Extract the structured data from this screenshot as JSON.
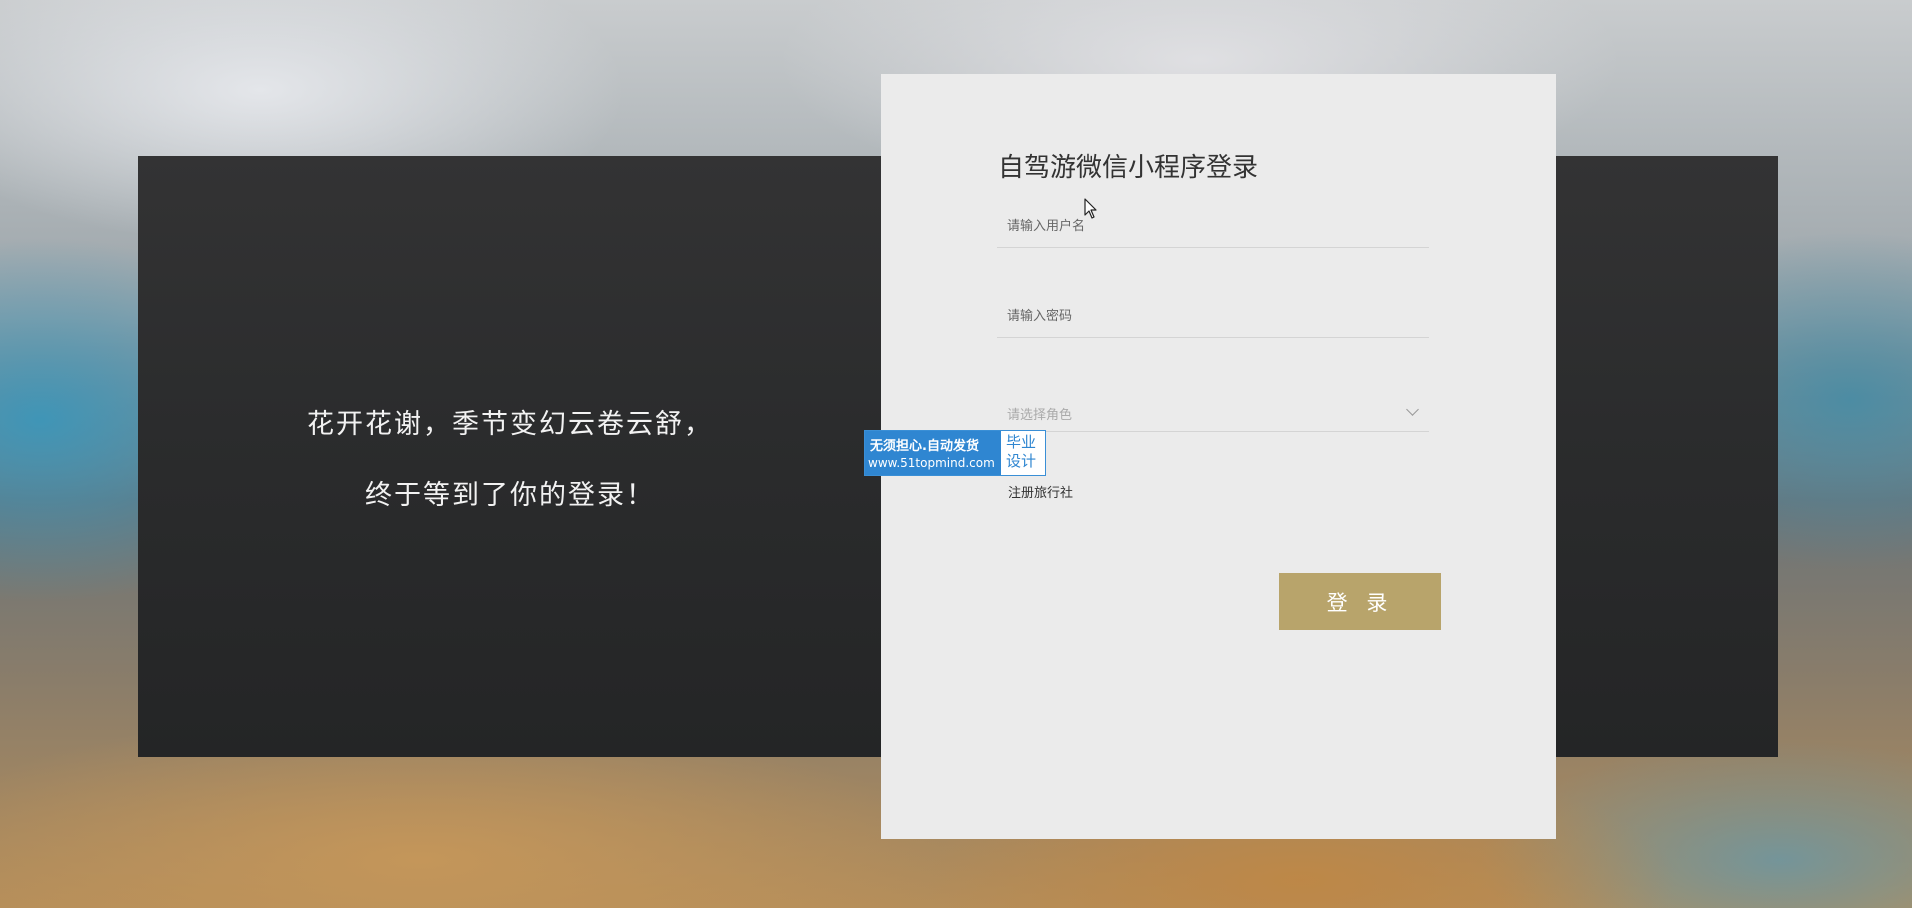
{
  "quote": {
    "line1": "花开花谢，季节变幻云卷云舒，",
    "line2": "终于等到了你的登录！"
  },
  "login": {
    "title": "自驾游微信小程序登录",
    "username_placeholder": "请输入用户名",
    "password_placeholder": "请输入密码",
    "role_placeholder": "请选择角色",
    "register_link": "注册旅行社",
    "login_button": "登 录"
  },
  "watermark": {
    "line1": "无须担心.自动发货",
    "line2": "www.51topmind.com",
    "badge": "毕业设计"
  },
  "colors": {
    "button": "#b8a46b",
    "card": "#ebebeb",
    "panel": "#2b2c2d"
  }
}
